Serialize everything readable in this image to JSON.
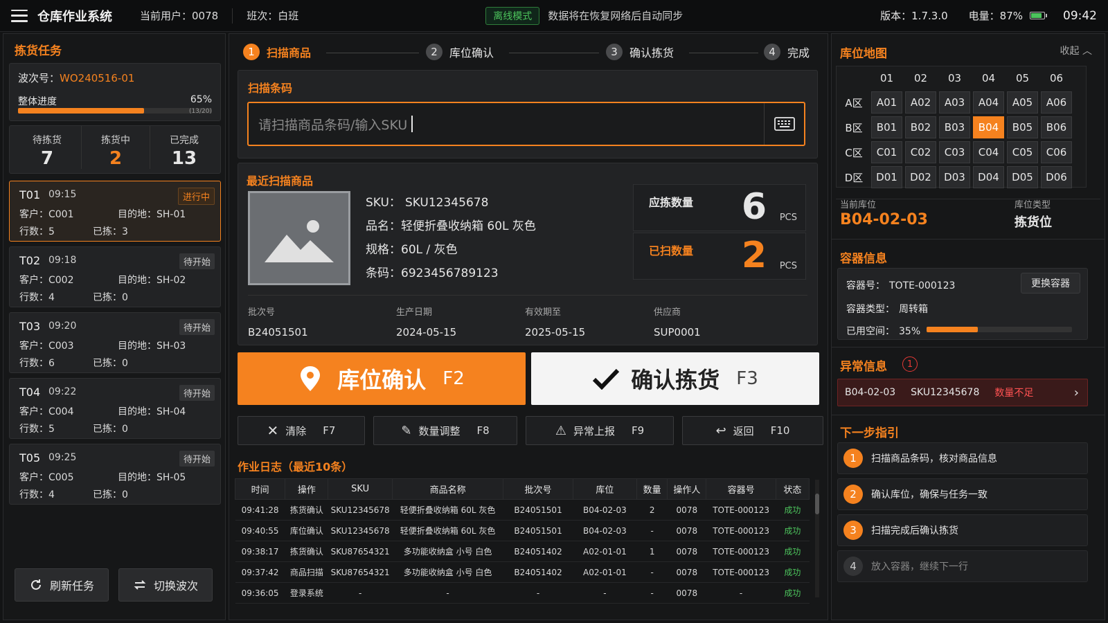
{
  "topbar": {
    "title": "仓库作业系统",
    "user": "当前用户：0078",
    "shift": "班次：白班",
    "mode_badge": "离线模式",
    "sync_text": "数据将在恢复网络后自动同步",
    "version": "版本：1.7.3.0",
    "battery": "电量：87%",
    "time": "09:42"
  },
  "left": {
    "title": "拣货任务",
    "wave_label": "波次号：",
    "wave_no": "WO240516-01",
    "progress_label": "整体进度",
    "progress_pct": "65%",
    "progress_value": 0.65,
    "progress_count": "(13/20)",
    "stats": [
      {
        "label": "待拣货",
        "value": "7"
      },
      {
        "label": "拣货中",
        "value": "2"
      },
      {
        "label": "已完成",
        "value": "13"
      }
    ],
    "tasks": [
      {
        "id": "T01",
        "time": "09:15",
        "status": "进行中",
        "customer": "客户：C001",
        "dest": "目的地：SH-01",
        "lines": "行数：5",
        "picked": "已拣：3"
      },
      {
        "id": "T02",
        "time": "09:18",
        "status": "待开始",
        "customer": "客户：C002",
        "dest": "目的地：SH-02",
        "lines": "行数：4",
        "picked": "已拣：0"
      },
      {
        "id": "T03",
        "time": "09:20",
        "status": "待开始",
        "customer": "客户：C003",
        "dest": "目的地：SH-03",
        "lines": "行数：6",
        "picked": "已拣：0"
      },
      {
        "id": "T04",
        "time": "09:22",
        "status": "待开始",
        "customer": "客户：C004",
        "dest": "目的地：SH-04",
        "lines": "行数：5",
        "picked": "已拣：0"
      },
      {
        "id": "T05",
        "time": "09:25",
        "status": "待开始",
        "customer": "客户：C005",
        "dest": "目的地：SH-05",
        "lines": "行数：4",
        "picked": "已拣：0"
      }
    ],
    "refresh_btn": "刷新任务",
    "switch_btn": "切换波次"
  },
  "center": {
    "steps": [
      "扫描商品",
      "库位确认",
      "确认拣货",
      "完成"
    ],
    "scan_title": "扫描条码",
    "scan_placeholder": "请扫描商品条码/输入SKU",
    "recent_title": "最近扫描商品",
    "product": {
      "sku_label": "SKU：",
      "sku": "SKU12345678",
      "name_label": "品名：",
      "name": "轻便折叠收纳箱 60L 灰色",
      "spec_label": "规格：",
      "spec": "60L / 灰色",
      "barcode_label": "条码：",
      "barcode": "6923456789123"
    },
    "qty_required_label": "应拣数量",
    "qty_required": "6",
    "qty_scanned_label": "已扫数量",
    "qty_scanned": "2",
    "unit": "PCS",
    "meta": [
      {
        "label": "批次号",
        "value": "B24051501"
      },
      {
        "label": "生产日期",
        "value": "2024-05-15"
      },
      {
        "label": "有效期至",
        "value": "2025-05-15"
      },
      {
        "label": "供应商",
        "value": "SUP0001"
      }
    ],
    "btn_location": {
      "label": "库位确认",
      "key": "F2"
    },
    "btn_confirm": {
      "label": "确认拣货",
      "key": "F3"
    },
    "small_btns": [
      {
        "label": "清除",
        "key": "F7"
      },
      {
        "label": "数量调整",
        "key": "F8"
      },
      {
        "label": "异常上报",
        "key": "F9"
      },
      {
        "label": "返回",
        "key": "F10"
      }
    ],
    "log_title": "作业日志（最近10条）",
    "log_headers": [
      "时间",
      "操作",
      "SKU",
      "商品名称",
      "批次号",
      "库位",
      "数量",
      "操作人",
      "容器号",
      "状态"
    ],
    "log_rows": [
      [
        "09:41:28",
        "拣货确认",
        "SKU12345678",
        "轻便折叠收纳箱 60L 灰色",
        "B24051501",
        "B04-02-03",
        "2",
        "0078",
        "TOTE-000123",
        "成功"
      ],
      [
        "09:40:55",
        "库位确认",
        "SKU12345678",
        "轻便折叠收纳箱 60L 灰色",
        "B24051501",
        "B04-02-03",
        "-",
        "0078",
        "TOTE-000123",
        "成功"
      ],
      [
        "09:38:17",
        "拣货确认",
        "SKU87654321",
        "多功能收纳盒 小号 白色",
        "B24051402",
        "A02-01-01",
        "1",
        "0078",
        "TOTE-000123",
        "成功"
      ],
      [
        "09:37:42",
        "商品扫描",
        "SKU87654321",
        "多功能收纳盒 小号 白色",
        "B24051402",
        "A02-01-01",
        "-",
        "0078",
        "TOTE-000123",
        "成功"
      ],
      [
        "09:36:05",
        "登录系统",
        "-",
        "-",
        "-",
        "-",
        "-",
        "0078",
        "-",
        "成功"
      ]
    ]
  },
  "right": {
    "map_title": "库位地图",
    "collapse": "收起",
    "cols": [
      "01",
      "02",
      "03",
      "04",
      "05",
      "06"
    ],
    "rows": [
      {
        "label": "A区",
        "cells": [
          "A01",
          "A02",
          "A03",
          "A04",
          "A05",
          "A06"
        ]
      },
      {
        "label": "B区",
        "cells": [
          "B01",
          "B02",
          "B03",
          "B04",
          "B05",
          "B06"
        ]
      },
      {
        "label": "C区",
        "cells": [
          "C01",
          "C02",
          "C03",
          "C04",
          "C05",
          "C06"
        ]
      },
      {
        "label": "D区",
        "cells": [
          "D01",
          "D02",
          "D03",
          "D04",
          "D05",
          "D06"
        ]
      }
    ],
    "selected_cell": "B04",
    "current_loc_label": "当前库位",
    "current_loc": "B04-02-03",
    "loc_type_label": "库位类型",
    "loc_type": "拣货位",
    "container_title": "容器信息",
    "container_no_label": "容器号：",
    "container_no": "TOTE-000123",
    "change_btn": "更换容器",
    "container_type_label": "容器类型：",
    "container_type": "周转箱",
    "used_label": "已用空间：",
    "used_pct": "35%",
    "used_value": 0.35,
    "exception_title": "异常信息",
    "exception_count": "1",
    "exception": {
      "loc": "B04-02-03",
      "sku": "SKU12345678",
      "msg": "数量不足"
    },
    "guide_title": "下一步指引",
    "guides": [
      {
        "num": "1",
        "text": "扫描商品条码，核对商品信息"
      },
      {
        "num": "2",
        "text": "确认库位，确保与任务一致"
      },
      {
        "num": "3",
        "text": "扫描完成后确认拣货"
      },
      {
        "num": "4",
        "text": "放入容器，继续下一行"
      }
    ]
  },
  "colors": {
    "accent": "#f5821f",
    "success": "#4cc35c",
    "danger": "#e53935"
  }
}
